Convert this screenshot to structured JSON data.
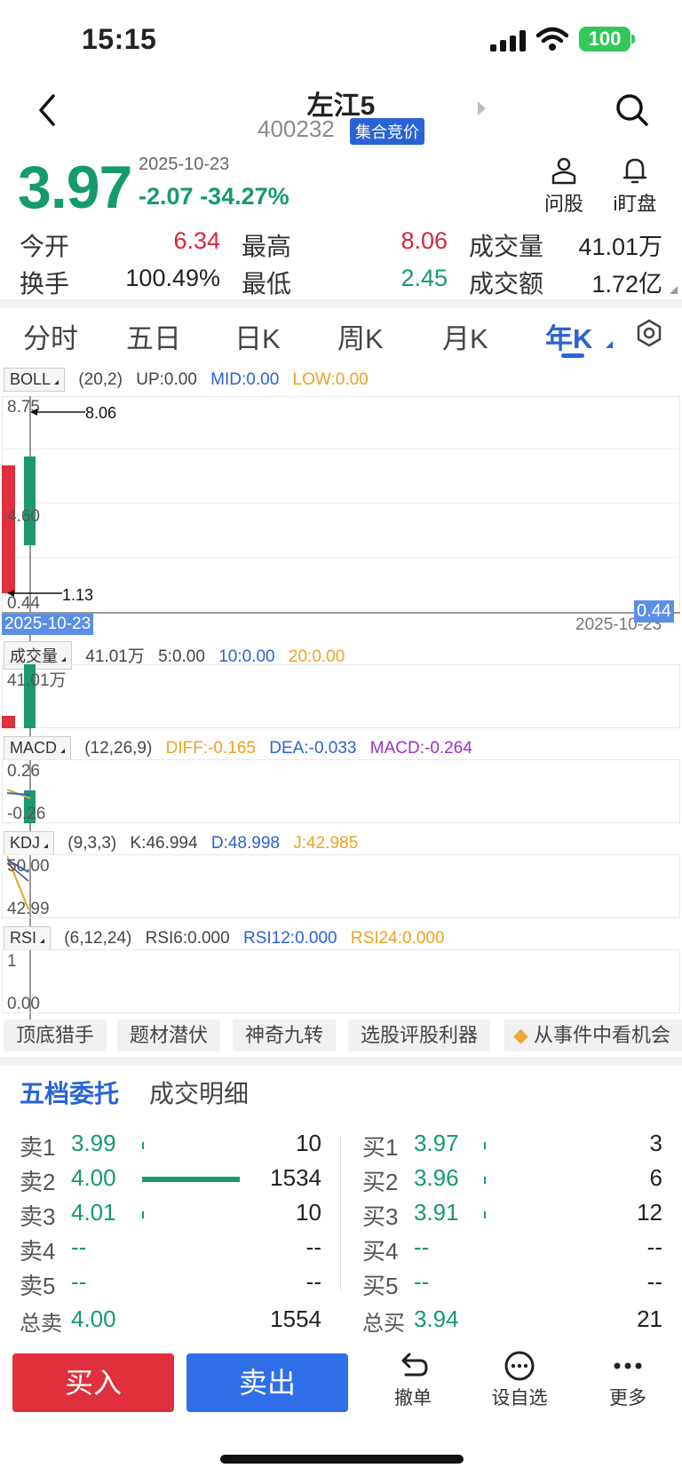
{
  "status": {
    "time": "15:15",
    "battery": "100"
  },
  "nav": {
    "title": "左江5",
    "code": "400232",
    "badge": "集合竞价"
  },
  "quote": {
    "price": "3.97",
    "date": "2025-10-23",
    "change": "-2.07",
    "change_pct": "-34.27%"
  },
  "actions": {
    "ask_label": "问股",
    "watch_label": "i盯盘"
  },
  "stats": [
    {
      "label": "今开",
      "value": "6.34",
      "color": "red"
    },
    {
      "label": "最高",
      "value": "8.06",
      "color": "red"
    },
    {
      "label": "成交量",
      "value": "41.01万",
      "color": "black"
    },
    {
      "label": "换手",
      "value": "100.49%",
      "color": "black"
    },
    {
      "label": "最低",
      "value": "2.45",
      "color": "green"
    },
    {
      "label": "成交额",
      "value": "1.72亿",
      "color": "black"
    }
  ],
  "tabs": [
    "分时",
    "五日",
    "日K",
    "周K",
    "月K",
    "年K"
  ],
  "boll": {
    "name": "BOLL",
    "params": "(20,2)",
    "up": "UP:0.00",
    "mid": "MID:0.00",
    "low": "LOW:0.00",
    "y_top": "8.75",
    "y_mid": "4.60",
    "y_bot": "0.44",
    "high_mark": "8.06",
    "low_mark": "1.13",
    "date_left": "2025-10-23",
    "date_right": "2025-10-23",
    "price_tag": "0.44"
  },
  "volume": {
    "name": "成交量",
    "total": "41.01万",
    "ma5": "5:0.00",
    "ma10": "10:0.00",
    "ma20": "20:0.00",
    "y_top": "41.01万"
  },
  "macd": {
    "name": "MACD",
    "params": "(12,26,9)",
    "diff": "DIFF:-0.165",
    "dea": "DEA:-0.033",
    "macd": "MACD:-0.264",
    "y_top": "0.26",
    "y_bot": "-0.26"
  },
  "kdj": {
    "name": "KDJ",
    "params": "(9,3,3)",
    "k": "K:46.994",
    "d": "D:48.998",
    "j": "J:42.985",
    "y_top": "50.00",
    "y_bot": "42.99"
  },
  "rsi": {
    "name": "RSI",
    "params": "(6,12,24)",
    "rsi6": "RSI6:0.000",
    "rsi12": "RSI12:0.000",
    "rsi24": "RSI24:0.000",
    "y_top": "1",
    "y_bot": "0.00"
  },
  "chips": [
    "顶底猎手",
    "题材潜伏",
    "神奇九转",
    "选股评股利器",
    "从事件中看机会"
  ],
  "orderbook": {
    "tab_active": "五档委托",
    "tab_other": "成交明细",
    "sell": [
      {
        "label": "卖1",
        "price": "3.99",
        "vol": "10",
        "share": 0.0065
      },
      {
        "label": "卖2",
        "price": "4.00",
        "vol": "1534",
        "share": 1.0
      },
      {
        "label": "卖3",
        "price": "4.01",
        "vol": "10",
        "share": 0.0065
      },
      {
        "label": "卖4",
        "price": "--",
        "vol": "--",
        "share": 0
      },
      {
        "label": "卖5",
        "price": "--",
        "vol": "--",
        "share": 0
      }
    ],
    "buy": [
      {
        "label": "买1",
        "price": "3.97",
        "vol": "3",
        "share": 0.002
      },
      {
        "label": "买2",
        "price": "3.96",
        "vol": "6",
        "share": 0.004
      },
      {
        "label": "买3",
        "price": "3.91",
        "vol": "12",
        "share": 0.008
      },
      {
        "label": "买4",
        "price": "--",
        "vol": "--",
        "share": 0
      },
      {
        "label": "买5",
        "price": "--",
        "vol": "--",
        "share": 0
      }
    ],
    "sell_total": {
      "label": "总卖",
      "price": "4.00",
      "vol": "1554"
    },
    "buy_total": {
      "label": "总买",
      "price": "3.94",
      "vol": "21"
    }
  },
  "bottom": {
    "buy": "买入",
    "sell": "卖出",
    "cancel": "撤单",
    "watchlist": "设自选",
    "more": "更多"
  }
}
